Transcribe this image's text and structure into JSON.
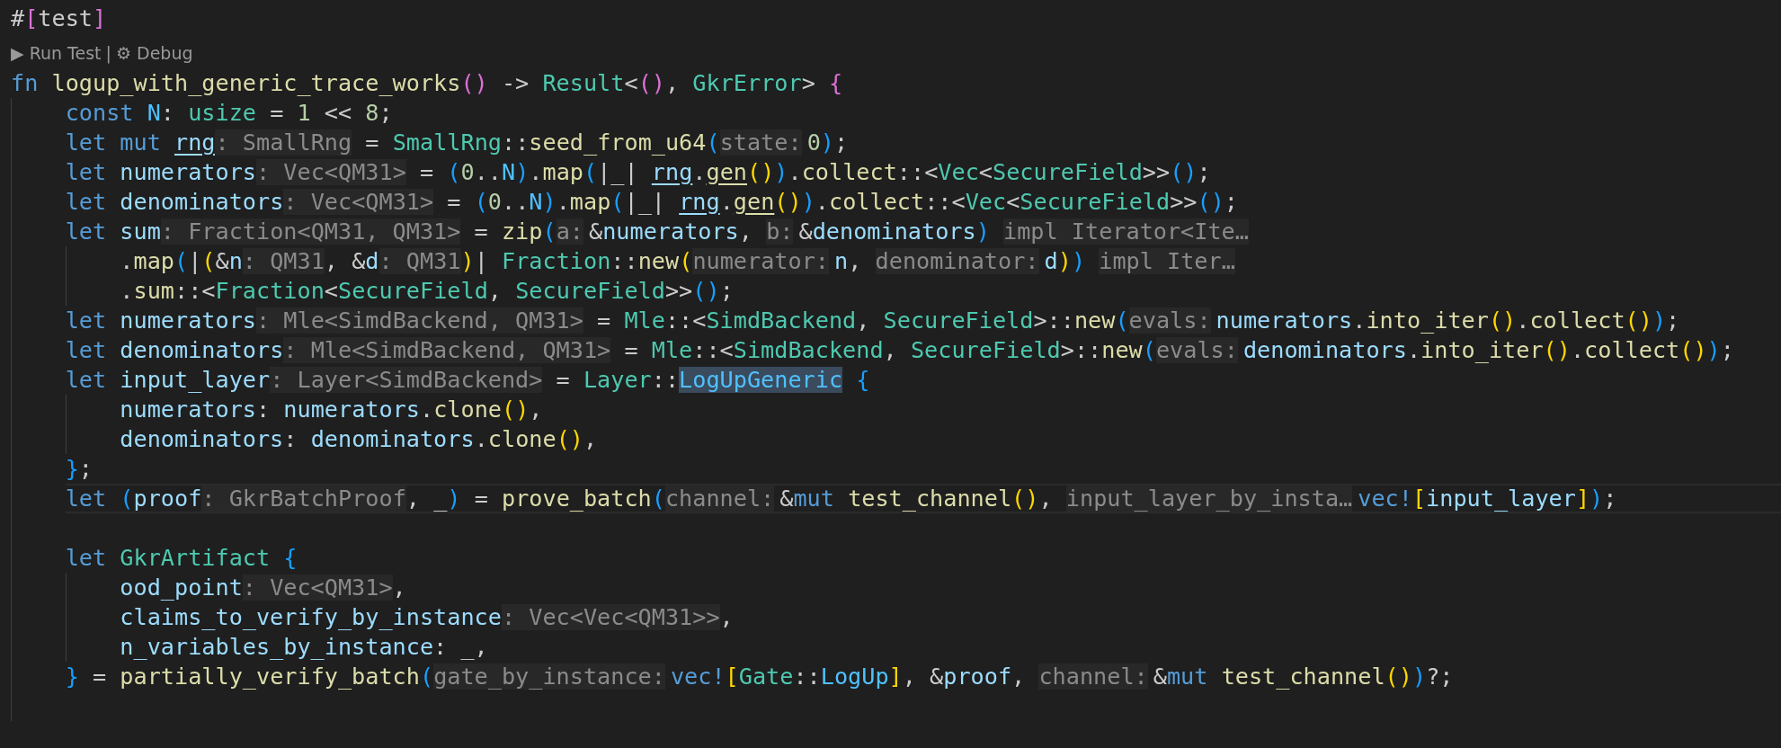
{
  "editor": {
    "lines": [
      {
        "kind": "code",
        "current": false,
        "tokens": [
          {
            "kind": "plain",
            "text": "#"
          },
          {
            "kind": "bracket2",
            "text": "["
          },
          {
            "kind": "plain",
            "text": "test"
          },
          {
            "kind": "bracket2",
            "text": "]"
          }
        ]
      },
      {
        "kind": "codelens",
        "actions": [
          {
            "text": "▶ Run Test"
          },
          {
            "text": "⚙ Debug"
          }
        ],
        "separator": "|"
      },
      {
        "kind": "code",
        "current": false,
        "tokens": [
          {
            "kind": "kw",
            "text": "fn "
          },
          {
            "kind": "fn",
            "text": "logup_with_generic_trace_works"
          },
          {
            "kind": "bracket2",
            "text": "()"
          },
          {
            "kind": "plain",
            "text": " -> "
          },
          {
            "kind": "type",
            "text": "Result"
          },
          {
            "kind": "plain",
            "text": "<"
          },
          {
            "kind": "bracket2",
            "text": "()"
          },
          {
            "kind": "plain",
            "text": ", "
          },
          {
            "kind": "type",
            "text": "GkrError"
          },
          {
            "kind": "plain",
            "text": "> "
          },
          {
            "kind": "bracket2",
            "text": "{"
          }
        ],
        "children": [
          {
            "kind": "code",
            "current": false,
            "tokens": [
              {
                "kind": "kw",
                "text": "const "
              },
              {
                "kind": "const",
                "text": "N"
              },
              {
                "kind": "plain",
                "text": ": "
              },
              {
                "kind": "type",
                "text": "usize"
              },
              {
                "kind": "plain",
                "text": " = "
              },
              {
                "kind": "num",
                "text": "1"
              },
              {
                "kind": "plain",
                "text": " << "
              },
              {
                "kind": "num",
                "text": "8"
              },
              {
                "kind": "plain",
                "text": ";"
              }
            ]
          },
          {
            "kind": "code",
            "current": false,
            "tokens": [
              {
                "kind": "kw",
                "text": "let mut "
              },
              {
                "kind": "mutvar",
                "text": "rng"
              },
              {
                "kind": "hint",
                "text": ": SmallRng"
              },
              {
                "kind": "plain",
                "text": " = "
              },
              {
                "kind": "type",
                "text": "SmallRng"
              },
              {
                "kind": "plain",
                "text": "::"
              },
              {
                "kind": "fn",
                "text": "seed_from_u64"
              },
              {
                "kind": "bracket3",
                "text": "("
              },
              {
                "kind": "param",
                "text": "state:"
              },
              {
                "kind": "num",
                "text": "0"
              },
              {
                "kind": "bracket3",
                "text": ")"
              },
              {
                "kind": "plain",
                "text": ";"
              }
            ]
          },
          {
            "kind": "code",
            "current": false,
            "tokens": [
              {
                "kind": "kw",
                "text": "let "
              },
              {
                "kind": "var",
                "text": "numerators"
              },
              {
                "kind": "hint",
                "text": ": Vec<QM31>"
              },
              {
                "kind": "plain",
                "text": " = "
              },
              {
                "kind": "bracket3",
                "text": "("
              },
              {
                "kind": "num",
                "text": "0"
              },
              {
                "kind": "plain",
                "text": ".."
              },
              {
                "kind": "const",
                "text": "N"
              },
              {
                "kind": "bracket3",
                "text": ")"
              },
              {
                "kind": "plain",
                "text": "."
              },
              {
                "kind": "fn",
                "text": "map"
              },
              {
                "kind": "bracket3",
                "text": "("
              },
              {
                "kind": "plain",
                "text": "|_| "
              },
              {
                "kind": "mutvar",
                "text": "rng"
              },
              {
                "kind": "plain",
                "text": "."
              },
              {
                "kind": "mutfn",
                "text": "gen"
              },
              {
                "kind": "bracket1",
                "text": "()"
              },
              {
                "kind": "bracket3",
                "text": ")"
              },
              {
                "kind": "plain",
                "text": "."
              },
              {
                "kind": "fn",
                "text": "collect"
              },
              {
                "kind": "plain",
                "text": "::<"
              },
              {
                "kind": "type",
                "text": "Vec"
              },
              {
                "kind": "plain",
                "text": "<"
              },
              {
                "kind": "type",
                "text": "SecureField"
              },
              {
                "kind": "plain",
                "text": ">>"
              },
              {
                "kind": "bracket3",
                "text": "()"
              },
              {
                "kind": "plain",
                "text": ";"
              }
            ]
          },
          {
            "kind": "code",
            "current": false,
            "tokens": [
              {
                "kind": "kw",
                "text": "let "
              },
              {
                "kind": "var",
                "text": "denominators"
              },
              {
                "kind": "hint",
                "text": ": Vec<QM31>"
              },
              {
                "kind": "plain",
                "text": " = "
              },
              {
                "kind": "bracket3",
                "text": "("
              },
              {
                "kind": "num",
                "text": "0"
              },
              {
                "kind": "plain",
                "text": ".."
              },
              {
                "kind": "const",
                "text": "N"
              },
              {
                "kind": "bracket3",
                "text": ")"
              },
              {
                "kind": "plain",
                "text": "."
              },
              {
                "kind": "fn",
                "text": "map"
              },
              {
                "kind": "bracket3",
                "text": "("
              },
              {
                "kind": "plain",
                "text": "|_| "
              },
              {
                "kind": "mutvar",
                "text": "rng"
              },
              {
                "kind": "plain",
                "text": "."
              },
              {
                "kind": "mutfn",
                "text": "gen"
              },
              {
                "kind": "bracket1",
                "text": "()"
              },
              {
                "kind": "bracket3",
                "text": ")"
              },
              {
                "kind": "plain",
                "text": "."
              },
              {
                "kind": "fn",
                "text": "collect"
              },
              {
                "kind": "plain",
                "text": "::<"
              },
              {
                "kind": "type",
                "text": "Vec"
              },
              {
                "kind": "plain",
                "text": "<"
              },
              {
                "kind": "type",
                "text": "SecureField"
              },
              {
                "kind": "plain",
                "text": ">>"
              },
              {
                "kind": "bracket3",
                "text": "()"
              },
              {
                "kind": "plain",
                "text": ";"
              }
            ]
          },
          {
            "kind": "code",
            "current": false,
            "tokens": [
              {
                "kind": "kw",
                "text": "let "
              },
              {
                "kind": "var",
                "text": "sum"
              },
              {
                "kind": "hint",
                "text": ": Fraction<QM31, QM31>"
              },
              {
                "kind": "plain",
                "text": " = "
              },
              {
                "kind": "fn",
                "text": "zip"
              },
              {
                "kind": "bracket3",
                "text": "("
              },
              {
                "kind": "param",
                "text": "a:"
              },
              {
                "kind": "plain",
                "text": "&"
              },
              {
                "kind": "var",
                "text": "numerators"
              },
              {
                "kind": "plain",
                "text": ", "
              },
              {
                "kind": "param",
                "text": "b:"
              },
              {
                "kind": "plain",
                "text": "&"
              },
              {
                "kind": "var",
                "text": "denominators"
              },
              {
                "kind": "bracket3",
                "text": ") "
              },
              {
                "kind": "hint",
                "text": "impl Iterator<Ite…"
              }
            ],
            "children": [
              {
                "kind": "code",
                "current": false,
                "tokens": [
                  {
                    "kind": "plain",
                    "text": "."
                  },
                  {
                    "kind": "fn",
                    "text": "map"
                  },
                  {
                    "kind": "bracket3",
                    "text": "("
                  },
                  {
                    "kind": "plain",
                    "text": "|"
                  },
                  {
                    "kind": "bracket1",
                    "text": "("
                  },
                  {
                    "kind": "plain",
                    "text": "&"
                  },
                  {
                    "kind": "var",
                    "text": "n"
                  },
                  {
                    "kind": "hint",
                    "text": ": QM31"
                  },
                  {
                    "kind": "plain",
                    "text": ", &"
                  },
                  {
                    "kind": "var",
                    "text": "d"
                  },
                  {
                    "kind": "hint",
                    "text": ": QM31"
                  },
                  {
                    "kind": "bracket1",
                    "text": ")"
                  },
                  {
                    "kind": "plain",
                    "text": "| "
                  },
                  {
                    "kind": "type",
                    "text": "Fraction"
                  },
                  {
                    "kind": "plain",
                    "text": "::"
                  },
                  {
                    "kind": "fn",
                    "text": "new"
                  },
                  {
                    "kind": "bracket1",
                    "text": "("
                  },
                  {
                    "kind": "param",
                    "text": "numerator:"
                  },
                  {
                    "kind": "var",
                    "text": "n"
                  },
                  {
                    "kind": "plain",
                    "text": ", "
                  },
                  {
                    "kind": "param",
                    "text": "denominator:"
                  },
                  {
                    "kind": "var",
                    "text": "d"
                  },
                  {
                    "kind": "bracket1",
                    "text": ")"
                  },
                  {
                    "kind": "bracket3",
                    "text": ") "
                  },
                  {
                    "kind": "hint",
                    "text": "impl Iter…"
                  }
                ]
              },
              {
                "kind": "code",
                "current": false,
                "tokens": [
                  {
                    "kind": "plain",
                    "text": "."
                  },
                  {
                    "kind": "fn",
                    "text": "sum"
                  },
                  {
                    "kind": "plain",
                    "text": "::<"
                  },
                  {
                    "kind": "type",
                    "text": "Fraction"
                  },
                  {
                    "kind": "plain",
                    "text": "<"
                  },
                  {
                    "kind": "type",
                    "text": "SecureField"
                  },
                  {
                    "kind": "plain",
                    "text": ", "
                  },
                  {
                    "kind": "type",
                    "text": "SecureField"
                  },
                  {
                    "kind": "plain",
                    "text": ">>"
                  },
                  {
                    "kind": "bracket3",
                    "text": "()"
                  },
                  {
                    "kind": "plain",
                    "text": ";"
                  }
                ]
              }
            ]
          },
          {
            "kind": "code",
            "current": false,
            "tokens": [
              {
                "kind": "kw",
                "text": "let "
              },
              {
                "kind": "var",
                "text": "numerators"
              },
              {
                "kind": "hint",
                "text": ": Mle<SimdBackend, QM31>"
              },
              {
                "kind": "plain",
                "text": " = "
              },
              {
                "kind": "type",
                "text": "Mle"
              },
              {
                "kind": "plain",
                "text": "::<"
              },
              {
                "kind": "type",
                "text": "SimdBackend"
              },
              {
                "kind": "plain",
                "text": ", "
              },
              {
                "kind": "type",
                "text": "SecureField"
              },
              {
                "kind": "plain",
                "text": ">::"
              },
              {
                "kind": "fn",
                "text": "new"
              },
              {
                "kind": "bracket3",
                "text": "("
              },
              {
                "kind": "param",
                "text": "evals:"
              },
              {
                "kind": "var",
                "text": "numerators"
              },
              {
                "kind": "plain",
                "text": "."
              },
              {
                "kind": "fn",
                "text": "into_iter"
              },
              {
                "kind": "bracket1",
                "text": "()"
              },
              {
                "kind": "plain",
                "text": "."
              },
              {
                "kind": "fn",
                "text": "collect"
              },
              {
                "kind": "bracket1",
                "text": "()"
              },
              {
                "kind": "bracket3",
                "text": ")"
              },
              {
                "kind": "plain",
                "text": ";"
              }
            ]
          },
          {
            "kind": "code",
            "current": false,
            "tokens": [
              {
                "kind": "kw",
                "text": "let "
              },
              {
                "kind": "var",
                "text": "denominators"
              },
              {
                "kind": "hint",
                "text": ": Mle<SimdBackend, QM31>"
              },
              {
                "kind": "plain",
                "text": " = "
              },
              {
                "kind": "type",
                "text": "Mle"
              },
              {
                "kind": "plain",
                "text": "::<"
              },
              {
                "kind": "type",
                "text": "SimdBackend"
              },
              {
                "kind": "plain",
                "text": ", "
              },
              {
                "kind": "type",
                "text": "SecureField"
              },
              {
                "kind": "plain",
                "text": ">::"
              },
              {
                "kind": "fn",
                "text": "new"
              },
              {
                "kind": "bracket3",
                "text": "("
              },
              {
                "kind": "param",
                "text": "evals:"
              },
              {
                "kind": "var",
                "text": "denominators"
              },
              {
                "kind": "plain",
                "text": "."
              },
              {
                "kind": "fn",
                "text": "into_iter"
              },
              {
                "kind": "bracket1",
                "text": "()"
              },
              {
                "kind": "plain",
                "text": "."
              },
              {
                "kind": "fn",
                "text": "collect"
              },
              {
                "kind": "bracket1",
                "text": "()"
              },
              {
                "kind": "bracket3",
                "text": ")"
              },
              {
                "kind": "plain",
                "text": ";"
              }
            ]
          },
          {
            "kind": "code",
            "current": false,
            "tokens": [
              {
                "kind": "kw",
                "text": "let "
              },
              {
                "kind": "var",
                "text": "input_layer"
              },
              {
                "kind": "hint",
                "text": ": Layer<SimdBackend>"
              },
              {
                "kind": "plain",
                "text": " = "
              },
              {
                "kind": "type",
                "text": "Layer"
              },
              {
                "kind": "plain",
                "text": "::"
              },
              {
                "kind": "match",
                "text": "LogUpGeneric"
              },
              {
                "kind": "bracket3",
                "text": " {"
              }
            ],
            "children": [
              {
                "kind": "code",
                "current": false,
                "tokens": [
                  {
                    "kind": "var",
                    "text": "numerators"
                  },
                  {
                    "kind": "plain",
                    "text": ": "
                  },
                  {
                    "kind": "var",
                    "text": "numerators"
                  },
                  {
                    "kind": "plain",
                    "text": "."
                  },
                  {
                    "kind": "fn",
                    "text": "clone"
                  },
                  {
                    "kind": "bracket1",
                    "text": "()"
                  },
                  {
                    "kind": "plain",
                    "text": ","
                  }
                ]
              },
              {
                "kind": "code",
                "current": false,
                "tokens": [
                  {
                    "kind": "var",
                    "text": "denominators"
                  },
                  {
                    "kind": "plain",
                    "text": ": "
                  },
                  {
                    "kind": "var",
                    "text": "denominators"
                  },
                  {
                    "kind": "plain",
                    "text": "."
                  },
                  {
                    "kind": "fn",
                    "text": "clone"
                  },
                  {
                    "kind": "bracket1",
                    "text": "()"
                  },
                  {
                    "kind": "plain",
                    "text": ","
                  }
                ]
              }
            ]
          },
          {
            "kind": "code",
            "current": false,
            "tokens": [
              {
                "kind": "bracket3",
                "text": "}"
              },
              {
                "kind": "plain",
                "text": ";"
              }
            ]
          },
          {
            "kind": "code",
            "current": true,
            "tokens": [
              {
                "kind": "kw",
                "text": "let "
              },
              {
                "kind": "bracket3",
                "text": "("
              },
              {
                "kind": "var",
                "text": "proof"
              },
              {
                "kind": "hint",
                "text": ": GkrBatchProof"
              },
              {
                "kind": "plain",
                "text": ", _"
              },
              {
                "kind": "bracket3",
                "text": ")"
              },
              {
                "kind": "plain",
                "text": " = "
              },
              {
                "kind": "fn",
                "text": "prove_batch"
              },
              {
                "kind": "bracket3",
                "text": "("
              },
              {
                "kind": "param",
                "text": "channel:"
              },
              {
                "kind": "plain",
                "text": "&"
              },
              {
                "kind": "kw",
                "text": "mut "
              },
              {
                "kind": "fn",
                "text": "test_channel"
              },
              {
                "kind": "bracket1",
                "text": "()"
              },
              {
                "kind": "plain",
                "text": ", "
              },
              {
                "kind": "param",
                "text": "input_layer_by_insta…"
              },
              {
                "kind": "macro",
                "text": "vec!"
              },
              {
                "kind": "bracket1",
                "text": "["
              },
              {
                "kind": "var",
                "text": "input_layer"
              },
              {
                "kind": "bracket1",
                "text": "]"
              },
              {
                "kind": "bracket3",
                "text": ")"
              },
              {
                "kind": "plain",
                "text": ";"
              }
            ]
          },
          {
            "kind": "blank"
          },
          {
            "kind": "code",
            "current": false,
            "tokens": [
              {
                "kind": "kw",
                "text": "let "
              },
              {
                "kind": "type",
                "text": "GkrArtifact"
              },
              {
                "kind": "bracket3",
                "text": " {"
              }
            ],
            "children": [
              {
                "kind": "code",
                "current": false,
                "tokens": [
                  {
                    "kind": "var",
                    "text": "ood_point"
                  },
                  {
                    "kind": "hint",
                    "text": ": Vec<QM31>"
                  },
                  {
                    "kind": "plain",
                    "text": ","
                  }
                ]
              },
              {
                "kind": "code",
                "current": false,
                "tokens": [
                  {
                    "kind": "var",
                    "text": "claims_to_verify_by_instance"
                  },
                  {
                    "kind": "hint",
                    "text": ": Vec<Vec<QM31>>"
                  },
                  {
                    "kind": "plain",
                    "text": ","
                  }
                ]
              },
              {
                "kind": "code",
                "current": false,
                "tokens": [
                  {
                    "kind": "var",
                    "text": "n_variables_by_instance"
                  },
                  {
                    "kind": "plain",
                    "text": ": _,"
                  }
                ]
              }
            ]
          },
          {
            "kind": "code",
            "current": false,
            "tokens": [
              {
                "kind": "bracket3",
                "text": "}"
              },
              {
                "kind": "plain",
                "text": " = "
              },
              {
                "kind": "fn",
                "text": "partially_verify_batch"
              },
              {
                "kind": "bracket3",
                "text": "("
              },
              {
                "kind": "param",
                "text": "gate_by_instance:"
              },
              {
                "kind": "macro",
                "text": "vec!"
              },
              {
                "kind": "bracket1",
                "text": "["
              },
              {
                "kind": "type",
                "text": "Gate"
              },
              {
                "kind": "plain",
                "text": "::"
              },
              {
                "kind": "const",
                "text": "LogUp"
              },
              {
                "kind": "bracket1",
                "text": "]"
              },
              {
                "kind": "plain",
                "text": ", &"
              },
              {
                "kind": "var",
                "text": "proof"
              },
              {
                "kind": "plain",
                "text": ", "
              },
              {
                "kind": "param",
                "text": "channel:"
              },
              {
                "kind": "plain",
                "text": "&"
              },
              {
                "kind": "kw",
                "text": "mut "
              },
              {
                "kind": "fn",
                "text": "test_channel"
              },
              {
                "kind": "bracket1",
                "text": "()"
              },
              {
                "kind": "bracket3",
                "text": ")"
              },
              {
                "kind": "plain",
                "text": "?;"
              }
            ]
          },
          {
            "kind": "blank"
          }
        ]
      }
    ]
  }
}
